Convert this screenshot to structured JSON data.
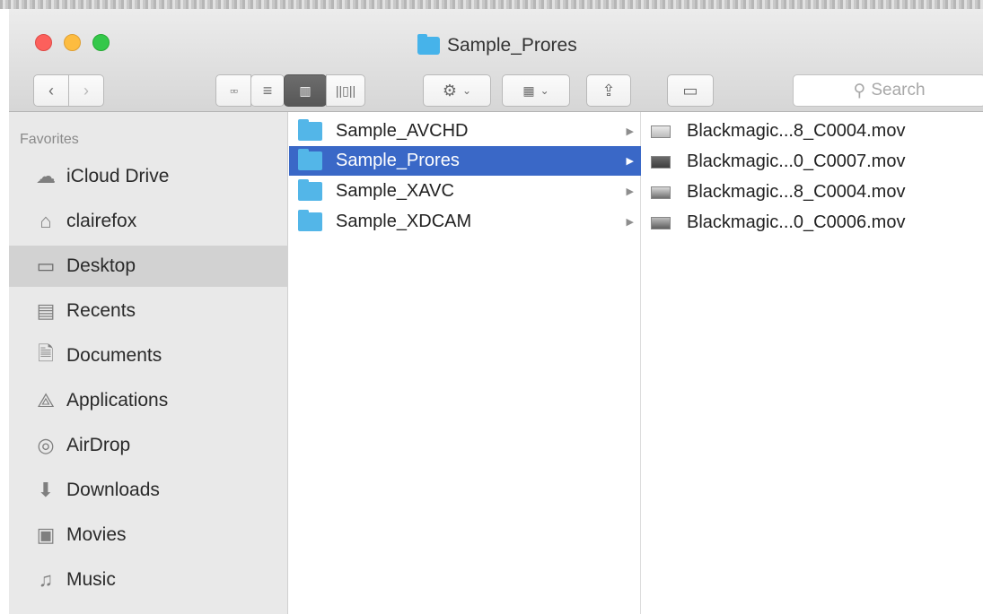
{
  "window": {
    "title": "Sample_Prores"
  },
  "toolbar": {
    "back_icon": "chevron-left",
    "forward_icon": "chevron-right",
    "search_placeholder": "Search"
  },
  "sidebar": {
    "section_label": "Favorites",
    "items": [
      {
        "label": "iCloud Drive",
        "icon": "cloud-icon"
      },
      {
        "label": "clairefox",
        "icon": "home-icon"
      },
      {
        "label": "Desktop",
        "icon": "desktop-icon",
        "selected": true
      },
      {
        "label": "Recents",
        "icon": "recents-icon"
      },
      {
        "label": "Documents",
        "icon": "documents-icon"
      },
      {
        "label": "Applications",
        "icon": "applications-icon"
      },
      {
        "label": "AirDrop",
        "icon": "airdrop-icon"
      },
      {
        "label": "Downloads",
        "icon": "downloads-icon"
      },
      {
        "label": "Movies",
        "icon": "movies-icon"
      },
      {
        "label": "Music",
        "icon": "music-icon"
      }
    ]
  },
  "columns": {
    "folders": [
      {
        "name": "Sample_AVCHD"
      },
      {
        "name": "Sample_Prores",
        "selected": true
      },
      {
        "name": "Sample_XAVC"
      },
      {
        "name": "Sample_XDCAM"
      }
    ],
    "files": [
      {
        "name": "Blackmagic...8_C0004.mov"
      },
      {
        "name": "Blackmagic...0_C0007.mov"
      },
      {
        "name": "Blackmagic...8_C0004.mov"
      },
      {
        "name": "Blackmagic...0_C0006.mov"
      }
    ]
  },
  "colors": {
    "selection": "#3a68c7",
    "folder": "#53b6e8",
    "close": "#fc605c",
    "minimize": "#fdbc40",
    "zoom": "#34c84a"
  }
}
